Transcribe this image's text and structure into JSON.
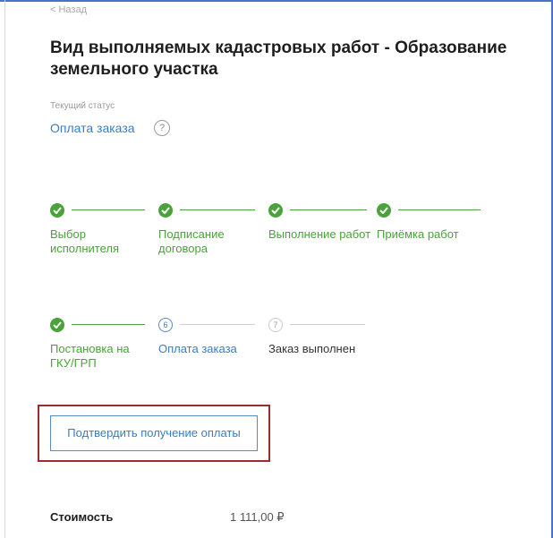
{
  "header": {
    "back_label": "< Назад",
    "title": "Вид выполняемых кадастровых работ - Образование земельного участка"
  },
  "status": {
    "caption": "Текущий статус",
    "value": "Оплата заказа",
    "help_symbol": "?"
  },
  "steps": [
    {
      "label": "Выбор исполнителя",
      "state": "done"
    },
    {
      "label": "Подписание договора",
      "state": "done"
    },
    {
      "label": "Выполнение работ",
      "state": "done"
    },
    {
      "label": "Приёмка работ",
      "state": "done"
    },
    {
      "label": "Постановка на ГКУ/ГРП",
      "state": "done"
    },
    {
      "label": "Оплата заказа",
      "state": "active",
      "number": "6"
    },
    {
      "label": "Заказ выполнен",
      "state": "pending",
      "number": "7"
    }
  ],
  "actions": {
    "confirm_label": "Подтвердить получение оплаты"
  },
  "cost": {
    "label": "Стоимость",
    "value": "1 111,00 ₽"
  },
  "colors": {
    "accent": "#3b7dbf",
    "done": "#4aa23a",
    "highlight": "#9e2b2b"
  }
}
